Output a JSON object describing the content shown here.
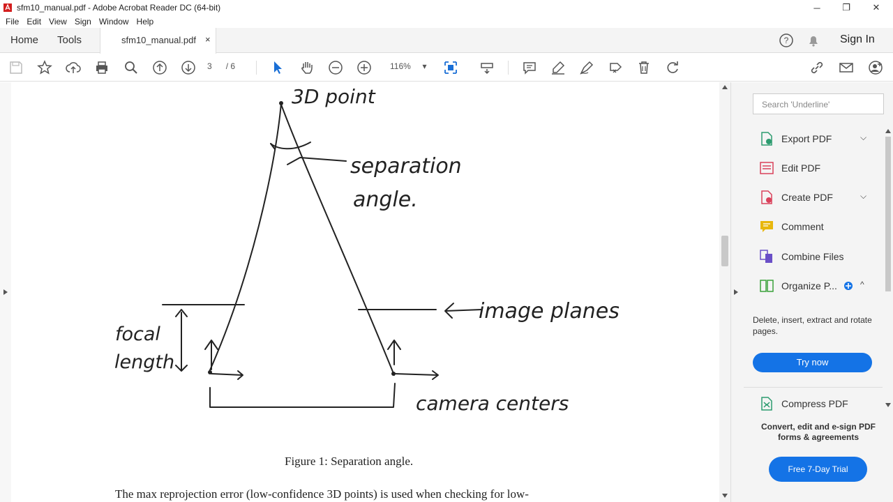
{
  "window": {
    "title": "sfm10_manual.pdf - Adobe Acrobat Reader DC (64-bit)",
    "min": "─",
    "restore": "❐",
    "close": "✕"
  },
  "menu": [
    "File",
    "Edit",
    "View",
    "Sign",
    "Window",
    "Help"
  ],
  "tabs": {
    "home": "Home",
    "tools": "Tools",
    "document": "sfm10_manual.pdf",
    "close": "×",
    "sign_in": "Sign In"
  },
  "toolbar": {
    "page_current": "3",
    "page_total": "/ 6",
    "zoom": "116%"
  },
  "document": {
    "sketch_labels": {
      "point": "3D point",
      "separation": "separation",
      "angle": "angle.",
      "image_planes": "image planes",
      "focal": "focal",
      "length": "length",
      "camera_centers": "camera centers"
    },
    "caption": "Figure 1: Separation angle.",
    "body_line": "The max reprojection error (low-confidence 3D points) is used when checking for low-"
  },
  "right_pane": {
    "search_placeholder": "Search 'Underline'",
    "tools": [
      {
        "label": "Export PDF",
        "color": "#2d9b6f"
      },
      {
        "label": "Edit PDF",
        "color": "#d9415b"
      },
      {
        "label": "Create PDF",
        "color": "#d9415b"
      },
      {
        "label": "Comment",
        "color": "#e8b70d"
      },
      {
        "label": "Combine Files",
        "color": "#6a4fc7"
      },
      {
        "label": "Organize P...",
        "color": "#3aa13a"
      },
      {
        "label": "Compress PDF",
        "color": "#2d9b6f"
      }
    ],
    "organize_desc": "Delete, insert, extract and rotate pages.",
    "try_now": "Try now",
    "promo": "Convert, edit and e-sign PDF forms & agreements",
    "free_trial": "Free 7-Day Trial"
  }
}
